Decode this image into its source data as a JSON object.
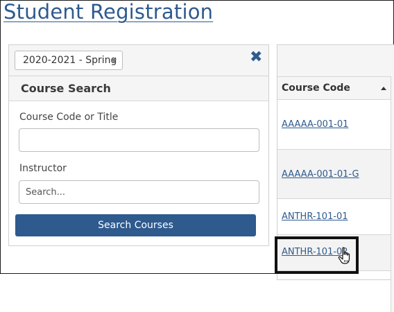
{
  "header": {
    "title": "Student Registration"
  },
  "search_panel": {
    "term_select": {
      "selected": "2020-2021 - Spring"
    },
    "close_icon": "close-x-icon",
    "section_title": "Course Search",
    "course_field": {
      "label": "Course Code or Title",
      "value": "",
      "placeholder": ""
    },
    "instructor_field": {
      "label": "Instructor",
      "value": "",
      "placeholder": "Search..."
    },
    "search_button": "Search Courses"
  },
  "results": {
    "columns": [
      {
        "label": "Course Code",
        "sort": "ascending"
      }
    ],
    "rows": [
      {
        "course_code": "AAAAA-001-01"
      },
      {
        "course_code": "AAAAA-001-01-G"
      },
      {
        "course_code": "ANTHR-101-01"
      },
      {
        "course_code": "ANTHR-101-02"
      }
    ]
  },
  "colors": {
    "accent": "#2e5a8e",
    "panel_bg": "#f5f5f5",
    "border": "#cfcfcf"
  }
}
